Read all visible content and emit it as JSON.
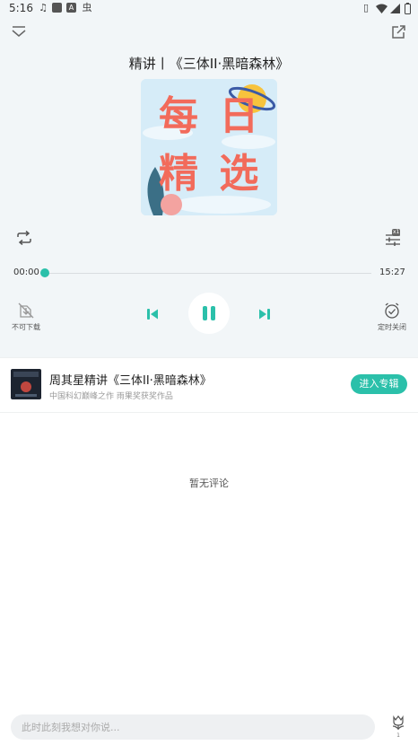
{
  "status_bar": {
    "time": "5:16",
    "icons": [
      "music-note-icon",
      "app-square-icon",
      "a-badge-icon",
      "bug-icon",
      "vibrate-icon",
      "wifi-icon",
      "signal-icon",
      "battery-icon"
    ]
  },
  "header": {
    "collapse_icon": "chevron-down-icon",
    "share_icon": "share-icon",
    "title": "精讲丨《三体II·黑暗森林》"
  },
  "cover": {
    "line1": "每 日",
    "line2": "精 选",
    "accent": "#f26b5b",
    "background": "#d6ecf8"
  },
  "controls_top": {
    "repeat_icon": "repeat-icon",
    "speed_icon": "speed-settings-icon",
    "speed_badge": "x1"
  },
  "progress": {
    "current_time": "00:00",
    "total_time": "15:27",
    "fraction": 0.0,
    "accent": "#2bc0aa"
  },
  "controls": {
    "download_label": "不可下载",
    "timer_label": "定时关闭",
    "prev_icon": "skip-previous-icon",
    "pause_icon": "pause-icon",
    "next_icon": "skip-next-icon"
  },
  "album": {
    "title": "周其星精讲《三体II·黑暗森林》",
    "subtitle": "中国科幻巅峰之作 雨果奖获奖作品",
    "button_label": "进入专辑"
  },
  "comments": {
    "empty_text": "暂无评论",
    "input_placeholder": "此时此刻我想对你说...",
    "gift_count": "1"
  }
}
